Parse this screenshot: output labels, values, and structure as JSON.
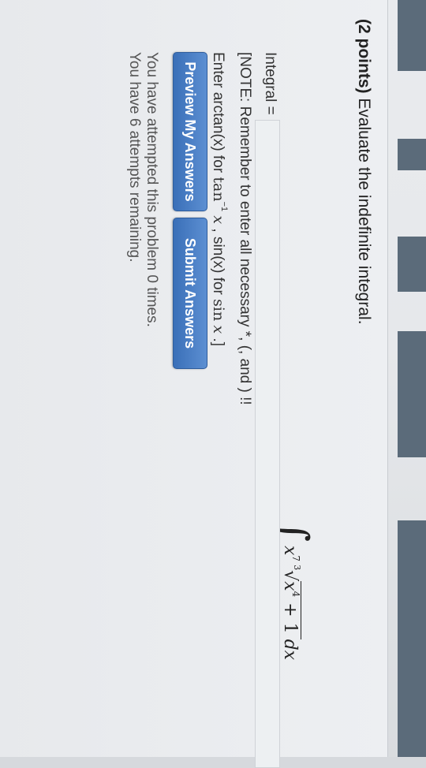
{
  "problem": {
    "points": "(2 points)",
    "prompt": " Evaluate the indefinite integral."
  },
  "integral": {
    "sign": "∫",
    "base": "x",
    "base_exp": "7",
    "root_index": "3",
    "radicand_var": "x",
    "radicand_exp": "4",
    "radicand_rest": " + 1 ",
    "differential": "dx"
  },
  "answer": {
    "label": "Integral =",
    "value": ""
  },
  "note": {
    "line1": "[NOTE: Remember to enter all necessary *, (, and ) !!",
    "line2_prefix": "Enter arctan(x) for ",
    "tan": "tan",
    "tan_sup": "−1",
    "tan_var": "x",
    "line2_mid": " , sin(x) for ",
    "sin": "sin",
    "sin_var": "x",
    "line2_end": " .]"
  },
  "buttons": {
    "preview": "Preview My Answers",
    "submit": "Submit Answers"
  },
  "attempts": {
    "made": "You have attempted this problem 0 times.",
    "remaining": "You have 6 attempts remaining."
  }
}
